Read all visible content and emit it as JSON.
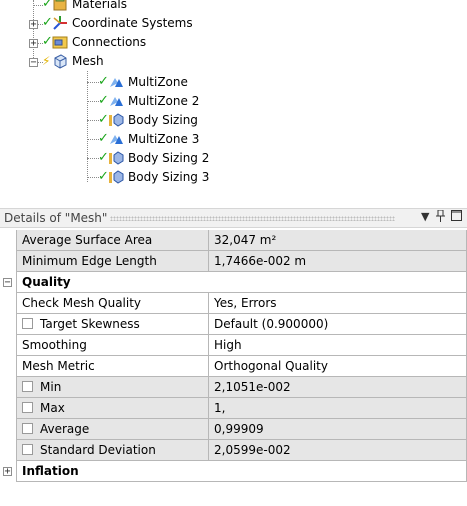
{
  "tree": {
    "items": [
      {
        "label": "Materials"
      },
      {
        "label": "Coordinate Systems"
      },
      {
        "label": "Connections"
      },
      {
        "label": "Mesh"
      },
      {
        "label": "MultiZone"
      },
      {
        "label": "MultiZone 2"
      },
      {
        "label": "Body Sizing"
      },
      {
        "label": "MultiZone 3"
      },
      {
        "label": "Body Sizing 2"
      },
      {
        "label": "Body Sizing 3"
      }
    ],
    "expand_plus": "+",
    "expand_minus": "−"
  },
  "details": {
    "title": "Details of \"Mesh\"",
    "dropdown_glyph": "▼",
    "pin_glyph": "ᵸ",
    "maximize_glyph": "☐",
    "rows": [
      {
        "label": "Average Surface Area",
        "value": "32,047 m²"
      },
      {
        "label": "Minimum Edge Length",
        "value": "1,7466e-002 m"
      }
    ],
    "quality_group": {
      "label": "Quality",
      "rows": [
        {
          "label": "Check Mesh Quality",
          "value": "Yes, Errors"
        },
        {
          "label": "Target Skewness",
          "value": "Default (0.900000)"
        },
        {
          "label": "Smoothing",
          "value": "High"
        },
        {
          "label": "Mesh Metric",
          "value": "Orthogonal Quality"
        },
        {
          "label": "Min",
          "value": "2,1051e-002"
        },
        {
          "label": "Max",
          "value": "1,"
        },
        {
          "label": "Average",
          "value": "0,99909"
        },
        {
          "label": "Standard Deviation",
          "value": "2,0599e-002"
        }
      ]
    },
    "inflation_group": {
      "label": "Inflation"
    }
  },
  "colors": {
    "row_gray": "#e6e6e6",
    "grid_line": "#b7b7b7",
    "check_green": "#1aa51a",
    "mesh_blue": "#2a6fd6"
  }
}
